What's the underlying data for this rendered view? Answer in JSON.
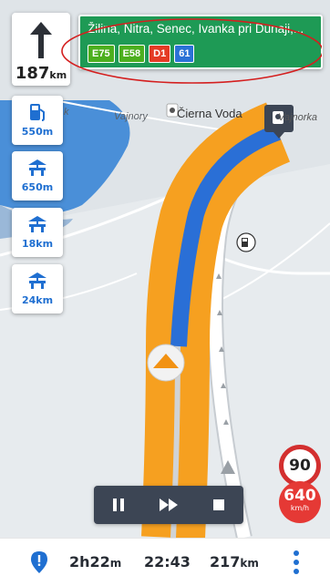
{
  "maneuver": {
    "distance_value": "187",
    "distance_unit": "km",
    "icon": "straight-arrow-icon"
  },
  "signpost": {
    "destinations": "Žilina, Nitra, Senec, Ivanka pri Dunaji,...",
    "routes": [
      {
        "label": "E75",
        "color": "#4caf1e"
      },
      {
        "label": "E58",
        "color": "#4caf1e"
      },
      {
        "label": "D1",
        "color": "#e53b25"
      },
      {
        "label": "61",
        "color": "#2a72d6"
      }
    ],
    "background": "#1e9a55"
  },
  "poi_list": [
    {
      "icon": "fuel-station-icon",
      "distance": "550m"
    },
    {
      "icon": "rest-area-icon",
      "distance": "650m"
    },
    {
      "icon": "rest-area-icon",
      "distance": "18km"
    },
    {
      "icon": "rest-area-icon",
      "distance": "24km"
    }
  ],
  "map_labels": {
    "vajnory": "Vajnory",
    "cierna_voda": "Čierna Voda",
    "vajnorka": "Vajnorka",
    "partial_k": "k"
  },
  "playback": {
    "controls": [
      "pause-icon",
      "fast-forward-icon",
      "stop-icon"
    ]
  },
  "speed": {
    "limit": "90",
    "current": "640",
    "unit": "km/h"
  },
  "trip": {
    "duration_h": "2h",
    "duration_m": "22",
    "duration_m_unit": "m",
    "eta": "22:43",
    "distance_value": "217",
    "distance_unit": "km"
  },
  "colors": {
    "route_orange": "#f6a020",
    "route_blue": "#2a6fd6",
    "accent_blue": "#1f6fd1",
    "speed_red": "#e53935",
    "annotation_red": "#d41f1f"
  }
}
